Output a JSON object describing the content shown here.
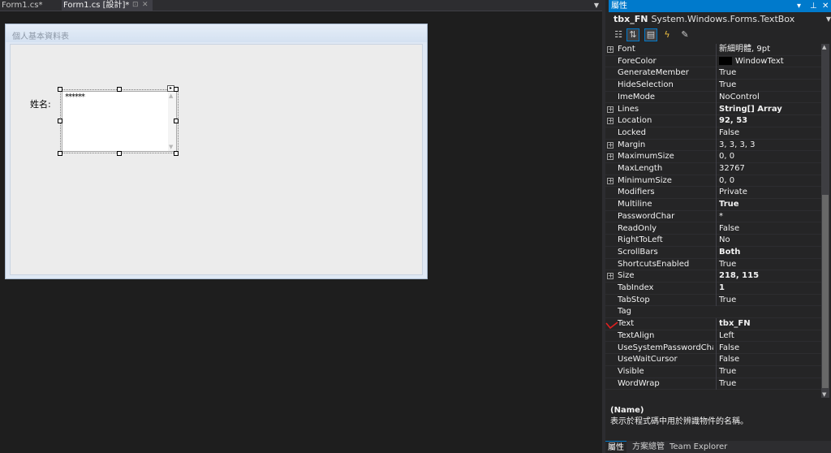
{
  "doc_tabs": [
    {
      "label": "Form1.cs*"
    },
    {
      "label": "Form1.cs [設計]*"
    }
  ],
  "form": {
    "title": "個人基本資料表",
    "label_name": "姓名:",
    "textbox_text": "******"
  },
  "properties": {
    "header_title": "屬性",
    "object_name": "tbx_FN",
    "object_type": "System.Windows.Forms.TextBox",
    "rows": [
      {
        "name": "Font",
        "value": "新細明體, 9pt",
        "expandable": true,
        "bold": false
      },
      {
        "name": "ForeColor",
        "value": "WindowText",
        "expandable": false,
        "bold": false,
        "swatch": "#000000"
      },
      {
        "name": "GenerateMember",
        "value": "True",
        "expandable": false,
        "bold": false
      },
      {
        "name": "HideSelection",
        "value": "True",
        "expandable": false,
        "bold": false
      },
      {
        "name": "ImeMode",
        "value": "NoControl",
        "expandable": false,
        "bold": false
      },
      {
        "name": "Lines",
        "value": "String[] Array",
        "expandable": true,
        "bold": true
      },
      {
        "name": "Location",
        "value": "92, 53",
        "expandable": true,
        "bold": true
      },
      {
        "name": "Locked",
        "value": "False",
        "expandable": false,
        "bold": false
      },
      {
        "name": "Margin",
        "value": "3, 3, 3, 3",
        "expandable": true,
        "bold": false
      },
      {
        "name": "MaximumSize",
        "value": "0, 0",
        "expandable": true,
        "bold": false
      },
      {
        "name": "MaxLength",
        "value": "32767",
        "expandable": false,
        "bold": false
      },
      {
        "name": "MinimumSize",
        "value": "0, 0",
        "expandable": true,
        "bold": false
      },
      {
        "name": "Modifiers",
        "value": "Private",
        "expandable": false,
        "bold": false
      },
      {
        "name": "Multiline",
        "value": "True",
        "expandable": false,
        "bold": true
      },
      {
        "name": "PasswordChar",
        "value": "*",
        "expandable": false,
        "bold": false
      },
      {
        "name": "ReadOnly",
        "value": "False",
        "expandable": false,
        "bold": false
      },
      {
        "name": "RightToLeft",
        "value": "No",
        "expandable": false,
        "bold": false
      },
      {
        "name": "ScrollBars",
        "value": "Both",
        "expandable": false,
        "bold": true
      },
      {
        "name": "ShortcutsEnabled",
        "value": "True",
        "expandable": false,
        "bold": false
      },
      {
        "name": "Size",
        "value": "218, 115",
        "expandable": true,
        "bold": true
      },
      {
        "name": "TabIndex",
        "value": "1",
        "expandable": false,
        "bold": true
      },
      {
        "name": "TabStop",
        "value": "True",
        "expandable": false,
        "bold": false
      },
      {
        "name": "Tag",
        "value": "",
        "expandable": false,
        "bold": false
      },
      {
        "name": "Text",
        "value": "tbx_FN",
        "expandable": false,
        "bold": true
      },
      {
        "name": "TextAlign",
        "value": "Left",
        "expandable": false,
        "bold": false
      },
      {
        "name": "UseSystemPasswordChar",
        "value": "False",
        "expandable": false,
        "bold": false
      },
      {
        "name": "UseWaitCursor",
        "value": "False",
        "expandable": false,
        "bold": false
      },
      {
        "name": "Visible",
        "value": "True",
        "expandable": false,
        "bold": false
      },
      {
        "name": "WordWrap",
        "value": "True",
        "expandable": false,
        "bold": false
      }
    ],
    "description_title": "(Name)",
    "description_text": "表示於程式碼中用於辨識物件的名稱。"
  },
  "bottom_tabs": [
    {
      "label": "屬性"
    },
    {
      "label": "方案總管"
    },
    {
      "label": "Team Explorer"
    }
  ],
  "colors": {
    "accent": "#007acc",
    "annotation": "#e02020"
  }
}
